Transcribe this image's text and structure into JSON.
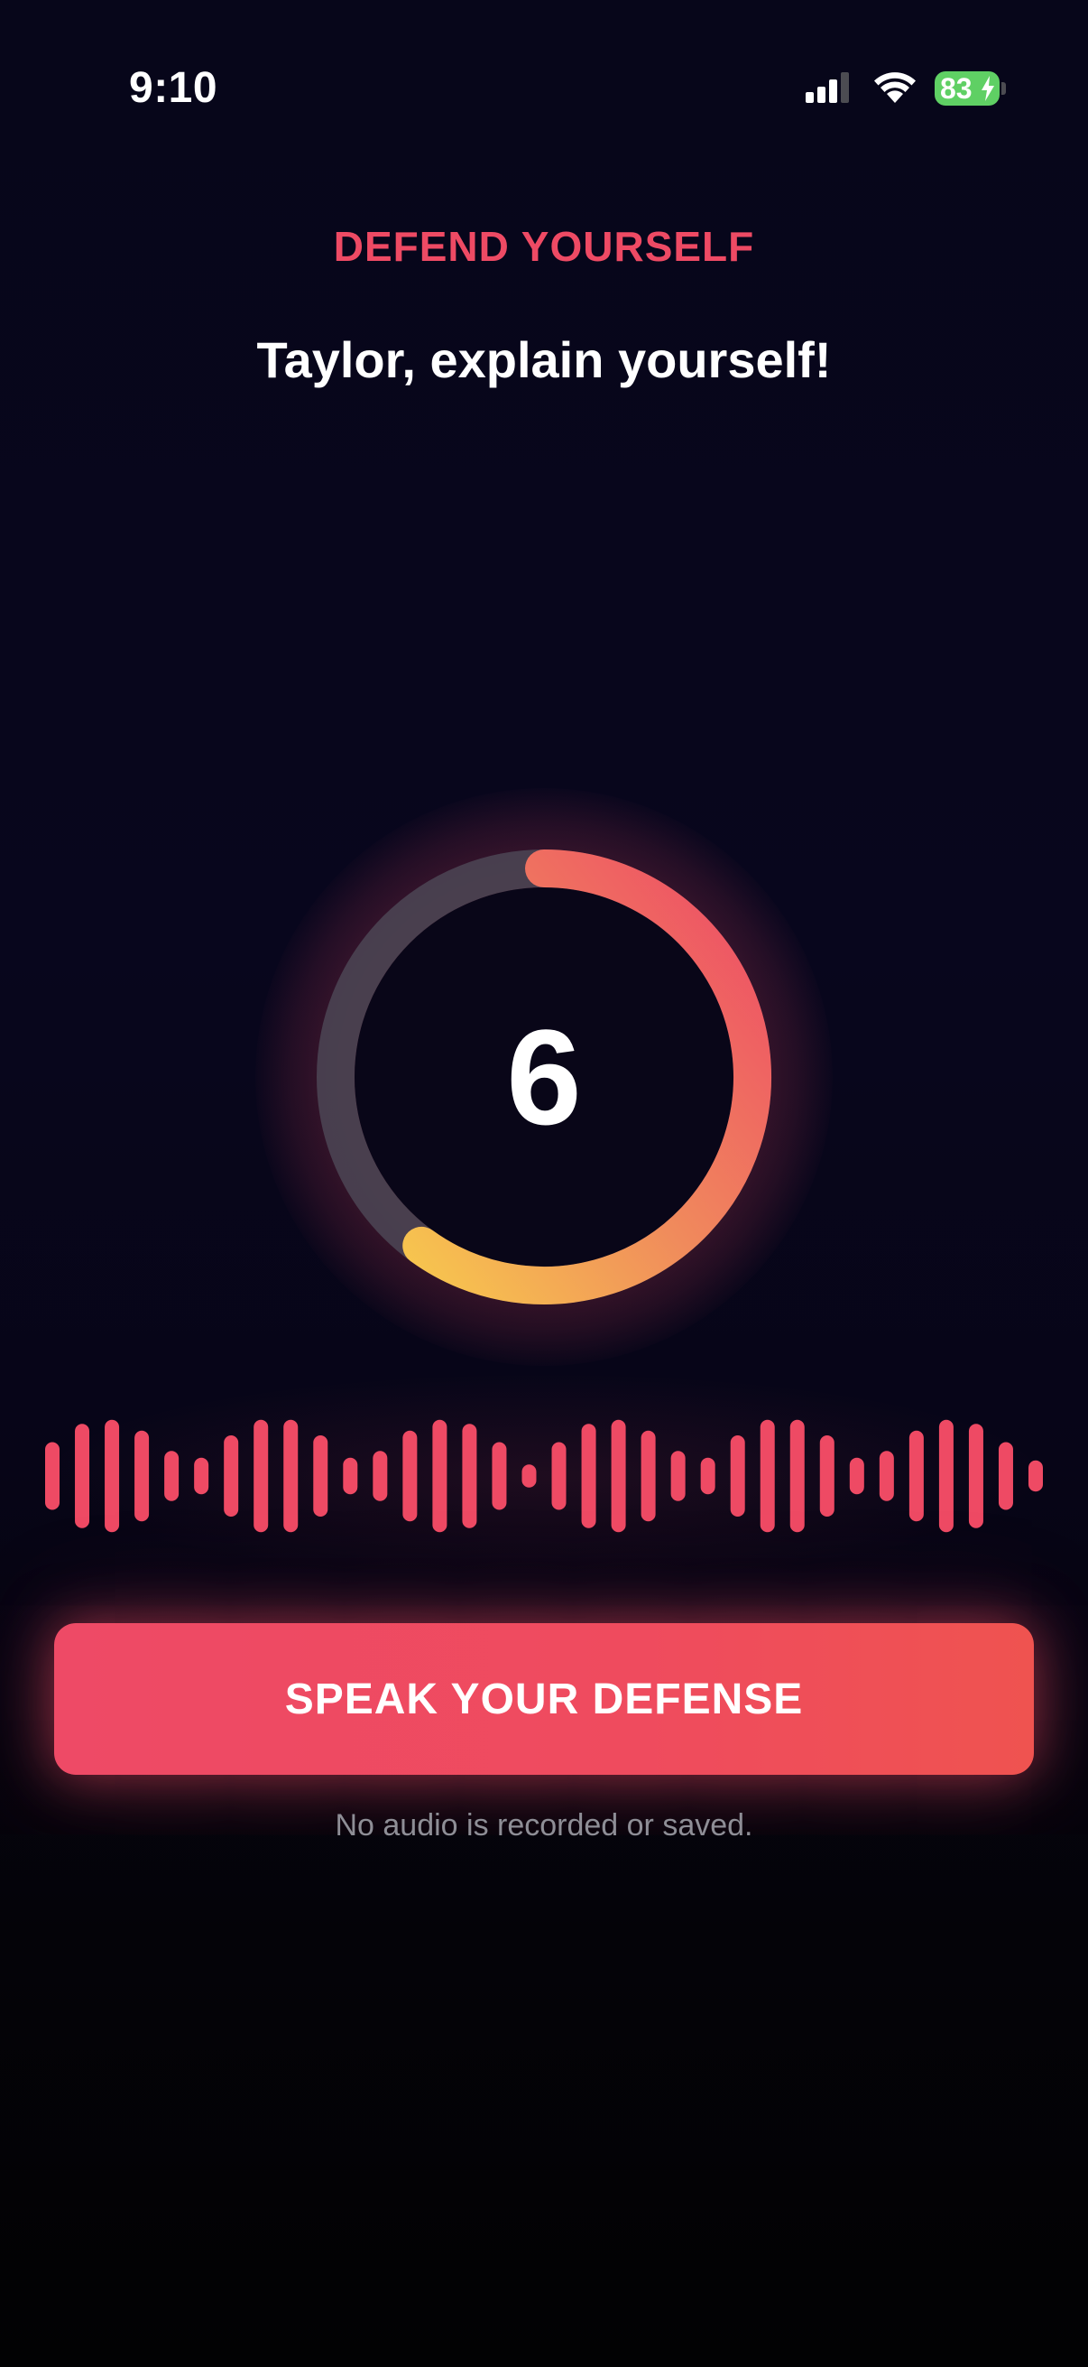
{
  "status_bar": {
    "time": "9:10",
    "battery_level": "83",
    "icons": [
      "cellular-signal-icon",
      "wifi-icon",
      "battery-charging-icon"
    ]
  },
  "header": {
    "eyebrow": "DEFEND YOURSELF",
    "headline": "Taylor, explain yourself!"
  },
  "timer": {
    "seconds_remaining": "6",
    "progress_fraction": 0.6
  },
  "waveform": {
    "bar_levels": [
      0.5,
      0.77,
      0.83,
      0.67,
      0.37,
      0.27,
      0.6,
      0.83,
      0.83,
      0.6,
      0.27,
      0.37,
      0.67,
      0.83,
      0.77,
      0.5,
      0.17,
      0.5,
      0.77,
      0.83,
      0.67,
      0.37,
      0.27,
      0.6,
      0.83,
      0.83,
      0.6,
      0.27,
      0.37,
      0.67,
      0.83,
      0.77,
      0.5,
      0.23
    ]
  },
  "action": {
    "button_label": "SPEAK YOUR DEFENSE",
    "disclaimer": "No audio is recorded or saved."
  },
  "colors": {
    "accent": "#ee4a64",
    "ring_gradient_start": "#f5bd4f",
    "ring_gradient_end": "#ee4a66",
    "ring_track": "#4a4452",
    "battery": "#5fd064",
    "muted_text": "#8e8e96"
  }
}
